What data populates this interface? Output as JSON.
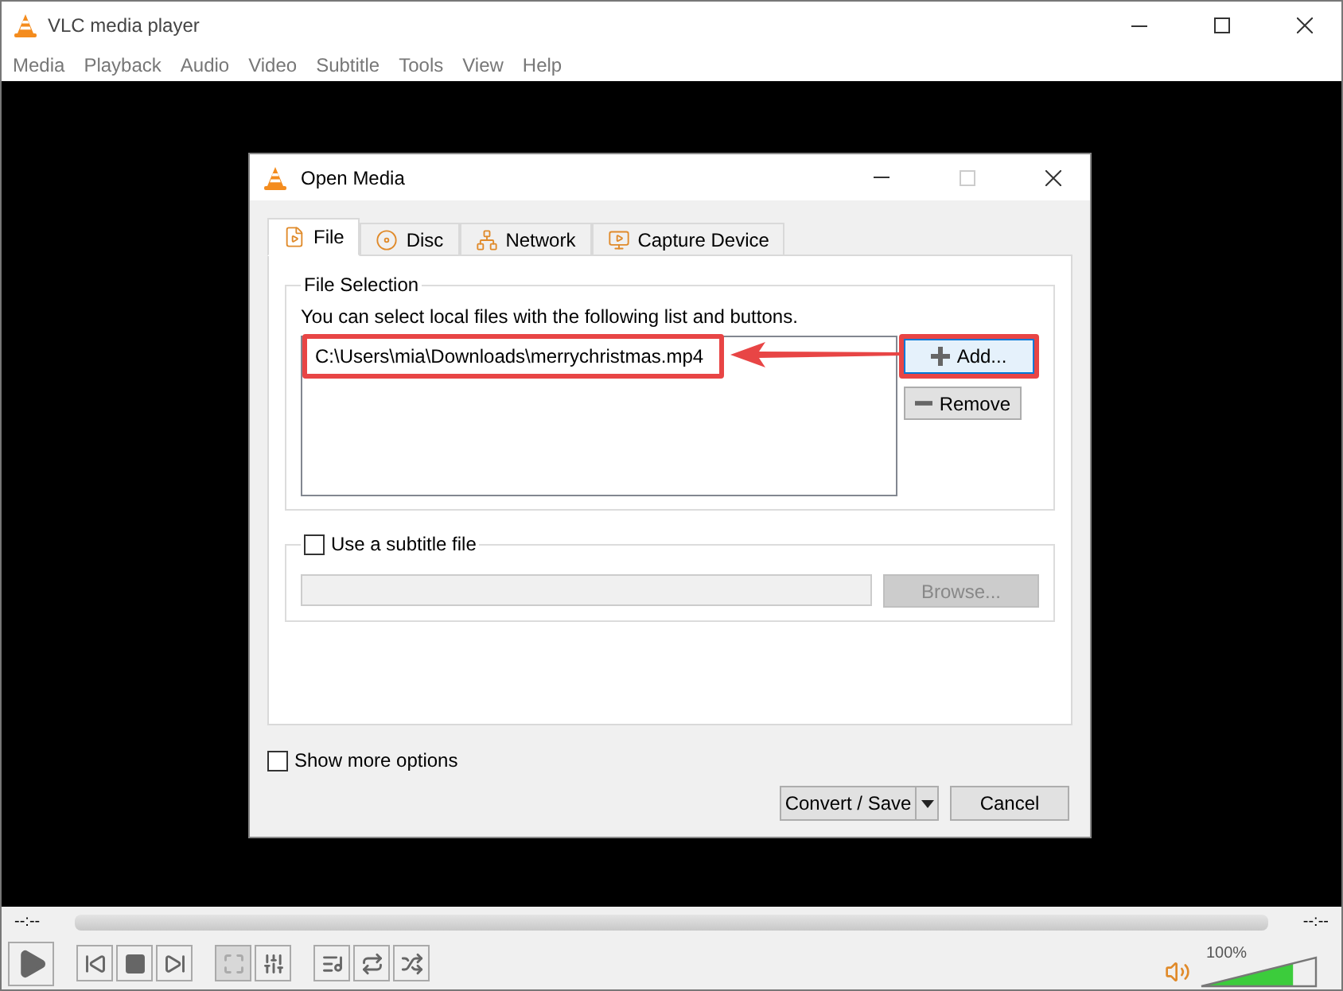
{
  "window": {
    "title": "VLC media player"
  },
  "menu": [
    "Media",
    "Playback",
    "Audio",
    "Video",
    "Subtitle",
    "Tools",
    "View",
    "Help"
  ],
  "dialog": {
    "title": "Open Media",
    "tabs": [
      {
        "label": "File",
        "kind": "file",
        "selected": true
      },
      {
        "label": "Disc",
        "kind": "disc",
        "selected": false
      },
      {
        "label": "Network",
        "kind": "network",
        "selected": false
      },
      {
        "label": "Capture Device",
        "kind": "capture",
        "selected": false
      }
    ],
    "file_selection": {
      "title": "File Selection",
      "hint": "You can select local files with the following list and buttons.",
      "files": [
        {
          "path": "C:\\Users\\mia\\Downloads\\merrychristmas.mp4",
          "highlighted": true
        }
      ],
      "add_button": {
        "label": "Add...",
        "highlighted": true
      },
      "remove_button": {
        "label": "Remove"
      }
    },
    "subtitle": {
      "label": "Use a subtitle file",
      "checked": false,
      "browse_button": {
        "label": "Browse...",
        "disabled": true
      }
    },
    "show_more_options": {
      "label": "Show more options",
      "checked": false
    },
    "convert_button": "Convert / Save",
    "cancel_button": "Cancel"
  },
  "player": {
    "elapsed": "--:--",
    "remaining": "--:--",
    "controls": [
      {
        "kind": "play",
        "disabled": false
      },
      {
        "kind": "previous",
        "disabled": false
      },
      {
        "kind": "stop",
        "disabled": false
      },
      {
        "kind": "next",
        "disabled": false
      },
      {
        "kind": "fullscreen",
        "disabled": true
      },
      {
        "kind": "effects",
        "disabled": false
      },
      {
        "kind": "playlist",
        "disabled": false
      },
      {
        "kind": "loop",
        "disabled": false
      },
      {
        "kind": "shuffle",
        "disabled": false
      }
    ],
    "volume": {
      "reading": "100%",
      "level": 0.8
    }
  }
}
